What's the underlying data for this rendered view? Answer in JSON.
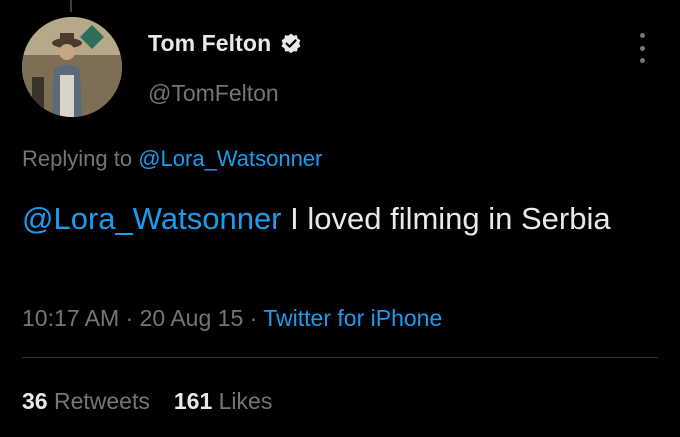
{
  "author": {
    "display_name": "Tom Felton",
    "handle": "@TomFelton",
    "verified": true
  },
  "reply": {
    "prefix": "Replying to",
    "to_handle": "@Lora_Watsonner"
  },
  "tweet": {
    "mention": "@Lora_Watsonner",
    "text": " I loved filming in Serbia"
  },
  "meta": {
    "time": "10:17 AM",
    "separator": " · ",
    "date": "20 Aug 15",
    "source": "Twitter for iPhone"
  },
  "stats": {
    "retweets_count": "36",
    "retweets_label": "Retweets",
    "likes_count": "161",
    "likes_label": "Likes"
  },
  "colors": {
    "background": "#000000",
    "primary_text": "#e7e9ea",
    "secondary_text": "#71767b",
    "link": "#1d9bf0",
    "divider": "#2f3336"
  },
  "icons": {
    "verified": "verified-badge-icon",
    "more": "more-vertical-icon"
  }
}
